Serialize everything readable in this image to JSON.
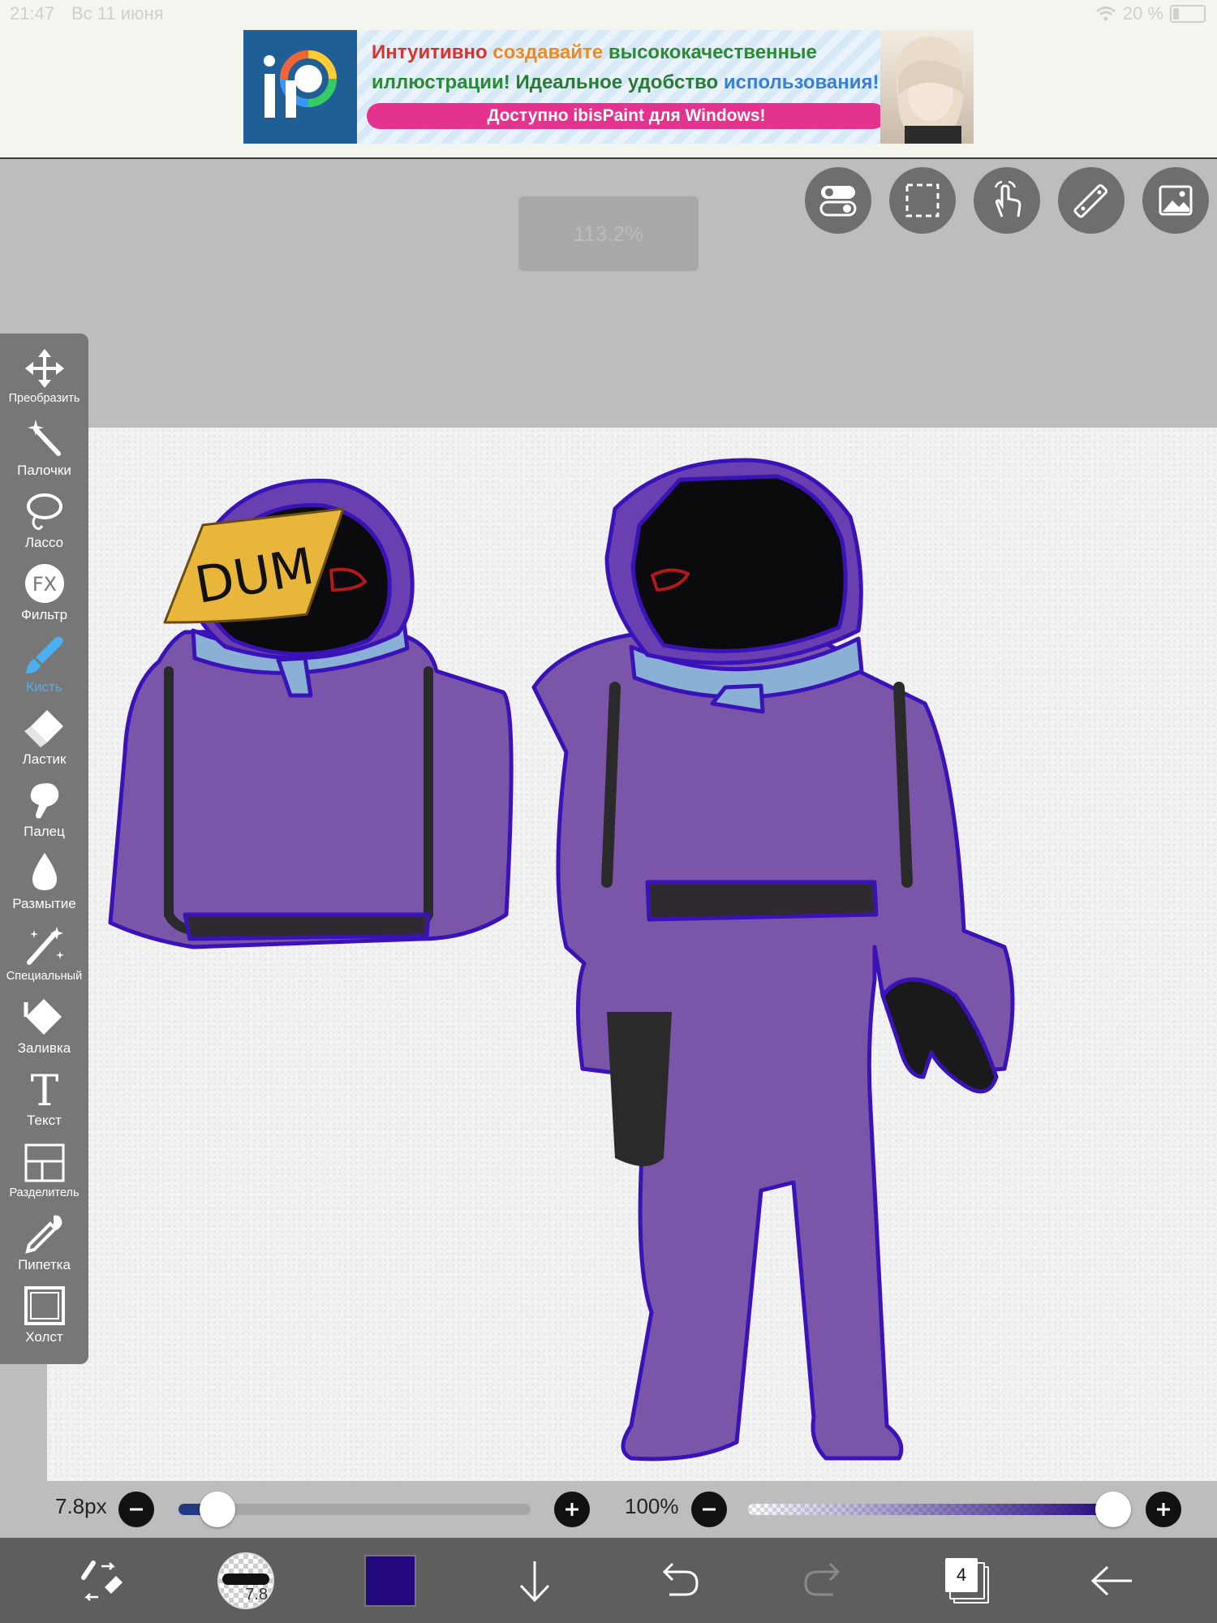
{
  "status_bar": {
    "time": "21:47",
    "date": "Вс 11 июня",
    "battery": "20 %"
  },
  "ad": {
    "line1_part1": "Интуитивно",
    "line1_part2": "создавайте",
    "line1_part3": "высококачественные",
    "line2_part1": "иллюстрации!",
    "line2_part2": "Идеальное удобство",
    "line2_part3": "использования!",
    "button": "Доступно ibisPaint для Windows!",
    "logo": "iP",
    "colors": {
      "red": "#d8332c",
      "orange": "#f08a1d",
      "green": "#2a8a35",
      "blue": "#3a7fd0",
      "pink": "#e3338f"
    }
  },
  "zoom_badge": "113.2%",
  "top_tools": [
    "toggle-icon",
    "selection-icon",
    "touch-icon",
    "ruler-icon",
    "reference-image-icon"
  ],
  "tools": [
    {
      "id": "transform",
      "label": "Преобразить",
      "icon": "move-arrows-icon"
    },
    {
      "id": "magic-wand",
      "label": "Палочки",
      "icon": "magic-wand-icon"
    },
    {
      "id": "lasso",
      "label": "Лассо",
      "icon": "lasso-icon"
    },
    {
      "id": "filter",
      "label": "Фильтр",
      "icon": "fx-icon"
    },
    {
      "id": "brush",
      "label": "Кисть",
      "icon": "brush-icon",
      "active": true
    },
    {
      "id": "eraser",
      "label": "Ластик",
      "icon": "eraser-icon"
    },
    {
      "id": "smudge",
      "label": "Палец",
      "icon": "smudge-icon"
    },
    {
      "id": "blur",
      "label": "Размытие",
      "icon": "blur-drop-icon"
    },
    {
      "id": "special",
      "label": "Специальный",
      "icon": "special-pen-icon"
    },
    {
      "id": "fill",
      "label": "Заливка",
      "icon": "fill-bucket-icon"
    },
    {
      "id": "text",
      "label": "Текст",
      "icon": "text-icon"
    },
    {
      "id": "divider",
      "label": "Разделитель",
      "icon": "frame-divider-icon"
    },
    {
      "id": "eyedropper",
      "label": "Пипетка",
      "icon": "eyedropper-icon"
    },
    {
      "id": "canvas",
      "label": "Холст",
      "icon": "canvas-icon"
    }
  ],
  "canvas": {
    "sticky_note_text": "DUM"
  },
  "brush": {
    "size_label": "7.8px",
    "size_fraction": 0.11,
    "opacity_label": "100%",
    "opacity_fraction": 1.0,
    "thumb_label": "7.8"
  },
  "color": {
    "current": "#24087f",
    "accent": "#4ab0f0"
  },
  "layers": {
    "count": "4"
  }
}
